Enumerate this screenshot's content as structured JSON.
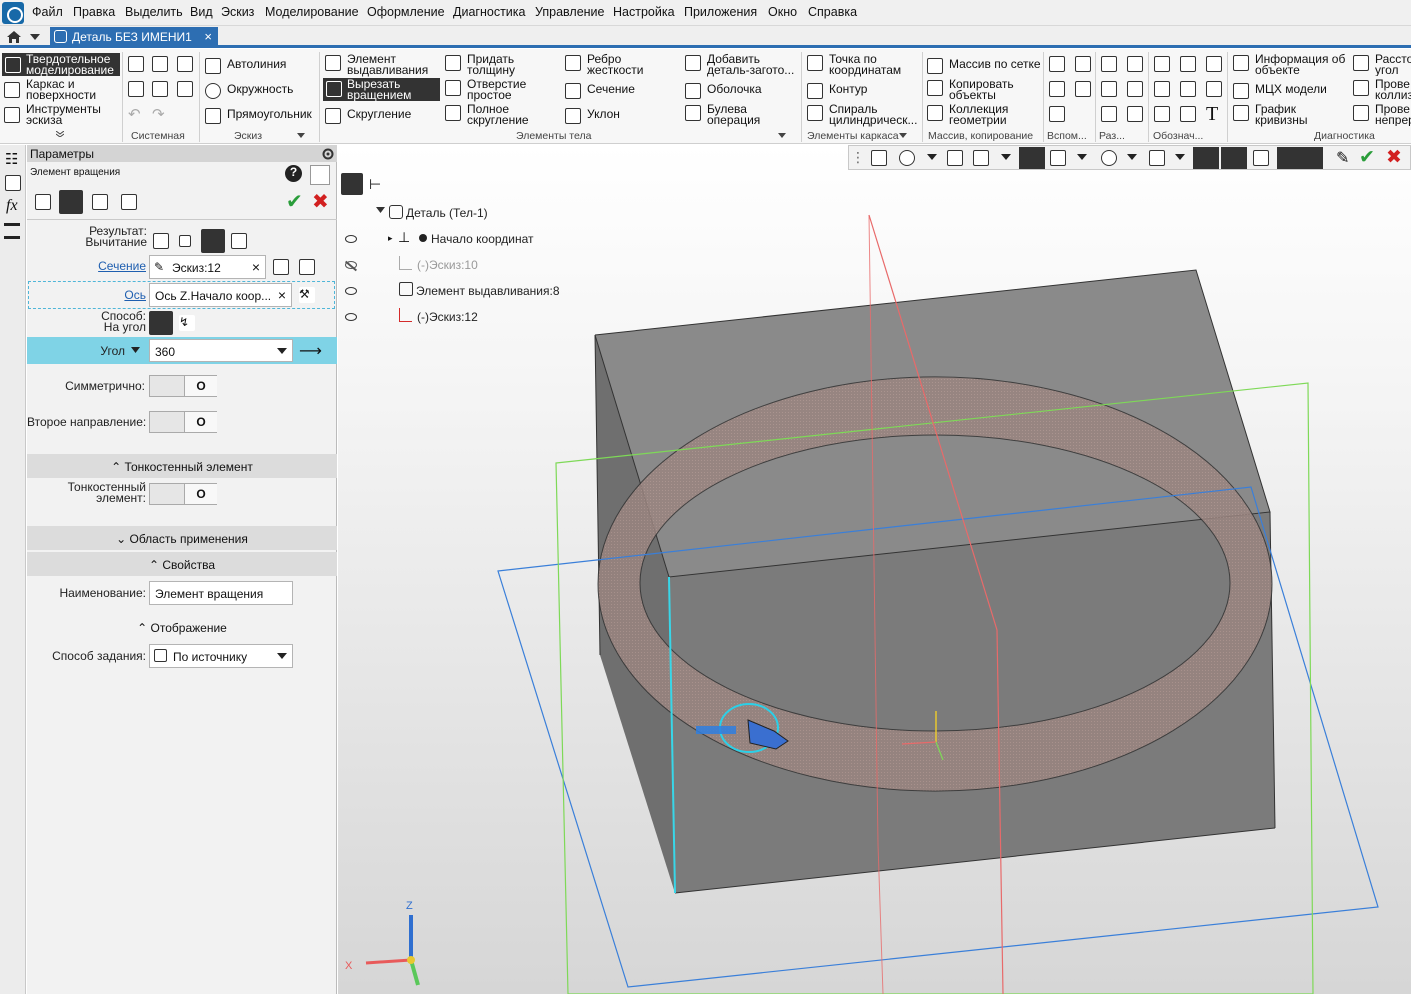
{
  "menu": [
    "Файл",
    "Правка",
    "Выделить",
    "Вид",
    "Эскиз",
    "Моделирование",
    "Оформление",
    "Диагностика",
    "Управление",
    "Настройка",
    "Приложения",
    "Окно",
    "Справка"
  ],
  "tab": {
    "title": "Деталь БЕЗ ИМЕНИ1",
    "close": "×"
  },
  "ribbon": {
    "modes": [
      "Твердотельное моделирование",
      "Каркас и поверхности",
      "Инструменты эскиза"
    ],
    "sketch": [
      "Автолиния",
      "Окружность",
      "Прямоугольник"
    ],
    "body_col1": [
      "Элемент выдавливания",
      "Вырезать вращением",
      "Скругление"
    ],
    "body_col2": [
      "Придать толщину",
      "Отверстие простое",
      "Полное скругление"
    ],
    "body_col3": [
      "Ребро жесткости",
      "Сечение",
      "Уклон"
    ],
    "body_col4": [
      "Добавить деталь-загото...",
      "Оболочка",
      "Булева операция"
    ],
    "frame": [
      "Точка по координатам",
      "Контур",
      "Спираль цилиндрическ..."
    ],
    "array": [
      "Массив по сетке",
      "Копировать объекты",
      "Коллекция геометрии"
    ],
    "diag": [
      "Информация об объекте",
      "МЦХ модели",
      "График кривизны"
    ],
    "diag_cut": [
      "Рассто угол",
      "Прове коллиз",
      "Прове непрер"
    ],
    "groups": [
      "Системная",
      "Эскиз",
      "Элементы тела",
      "Элементы каркаса",
      "Массив, копирование",
      "Вспом...",
      "Раз...",
      "Обознач...",
      "Диагностика"
    ]
  },
  "panel": {
    "title": "Параметры",
    "subtitle": "Элемент вращения",
    "result_label": "Результат:",
    "result_value": "Вычитание",
    "section_label": "Сечение",
    "section_value": "Эскиз:12",
    "axis_label": "Ось",
    "axis_value": "Ось Z.Начало коор...",
    "method_label": "Способ:",
    "method_value": "На угол",
    "angle_label": "Угол",
    "angle_value": "360",
    "symmetric_label": "Симметрично:",
    "second_dir_label": "Второе направление:",
    "toggle_off": "О",
    "thin_section": "Тонкостенный элемент",
    "thin_label": "Тонкостенный элемент:",
    "scope_section": "Область применения",
    "props_section": "Свойства",
    "name_label": "Наименование:",
    "name_value": "Элемент вращения",
    "display_section": "Отображение",
    "spec_label": "Способ задания:",
    "spec_value": "По источнику"
  },
  "tree": {
    "root": "Деталь (Тел-1)",
    "items": [
      "Начало координат",
      "(-)Эскиз:10",
      "Элемент выдавливания:8",
      "(-)Эскиз:12"
    ]
  },
  "axes": {
    "x": "X",
    "z": "Z"
  },
  "colors": {
    "accent": "#2d6eb2",
    "highlight": "#7fd3e6",
    "ok": "#2a9d3a",
    "cancel": "#d22020"
  }
}
